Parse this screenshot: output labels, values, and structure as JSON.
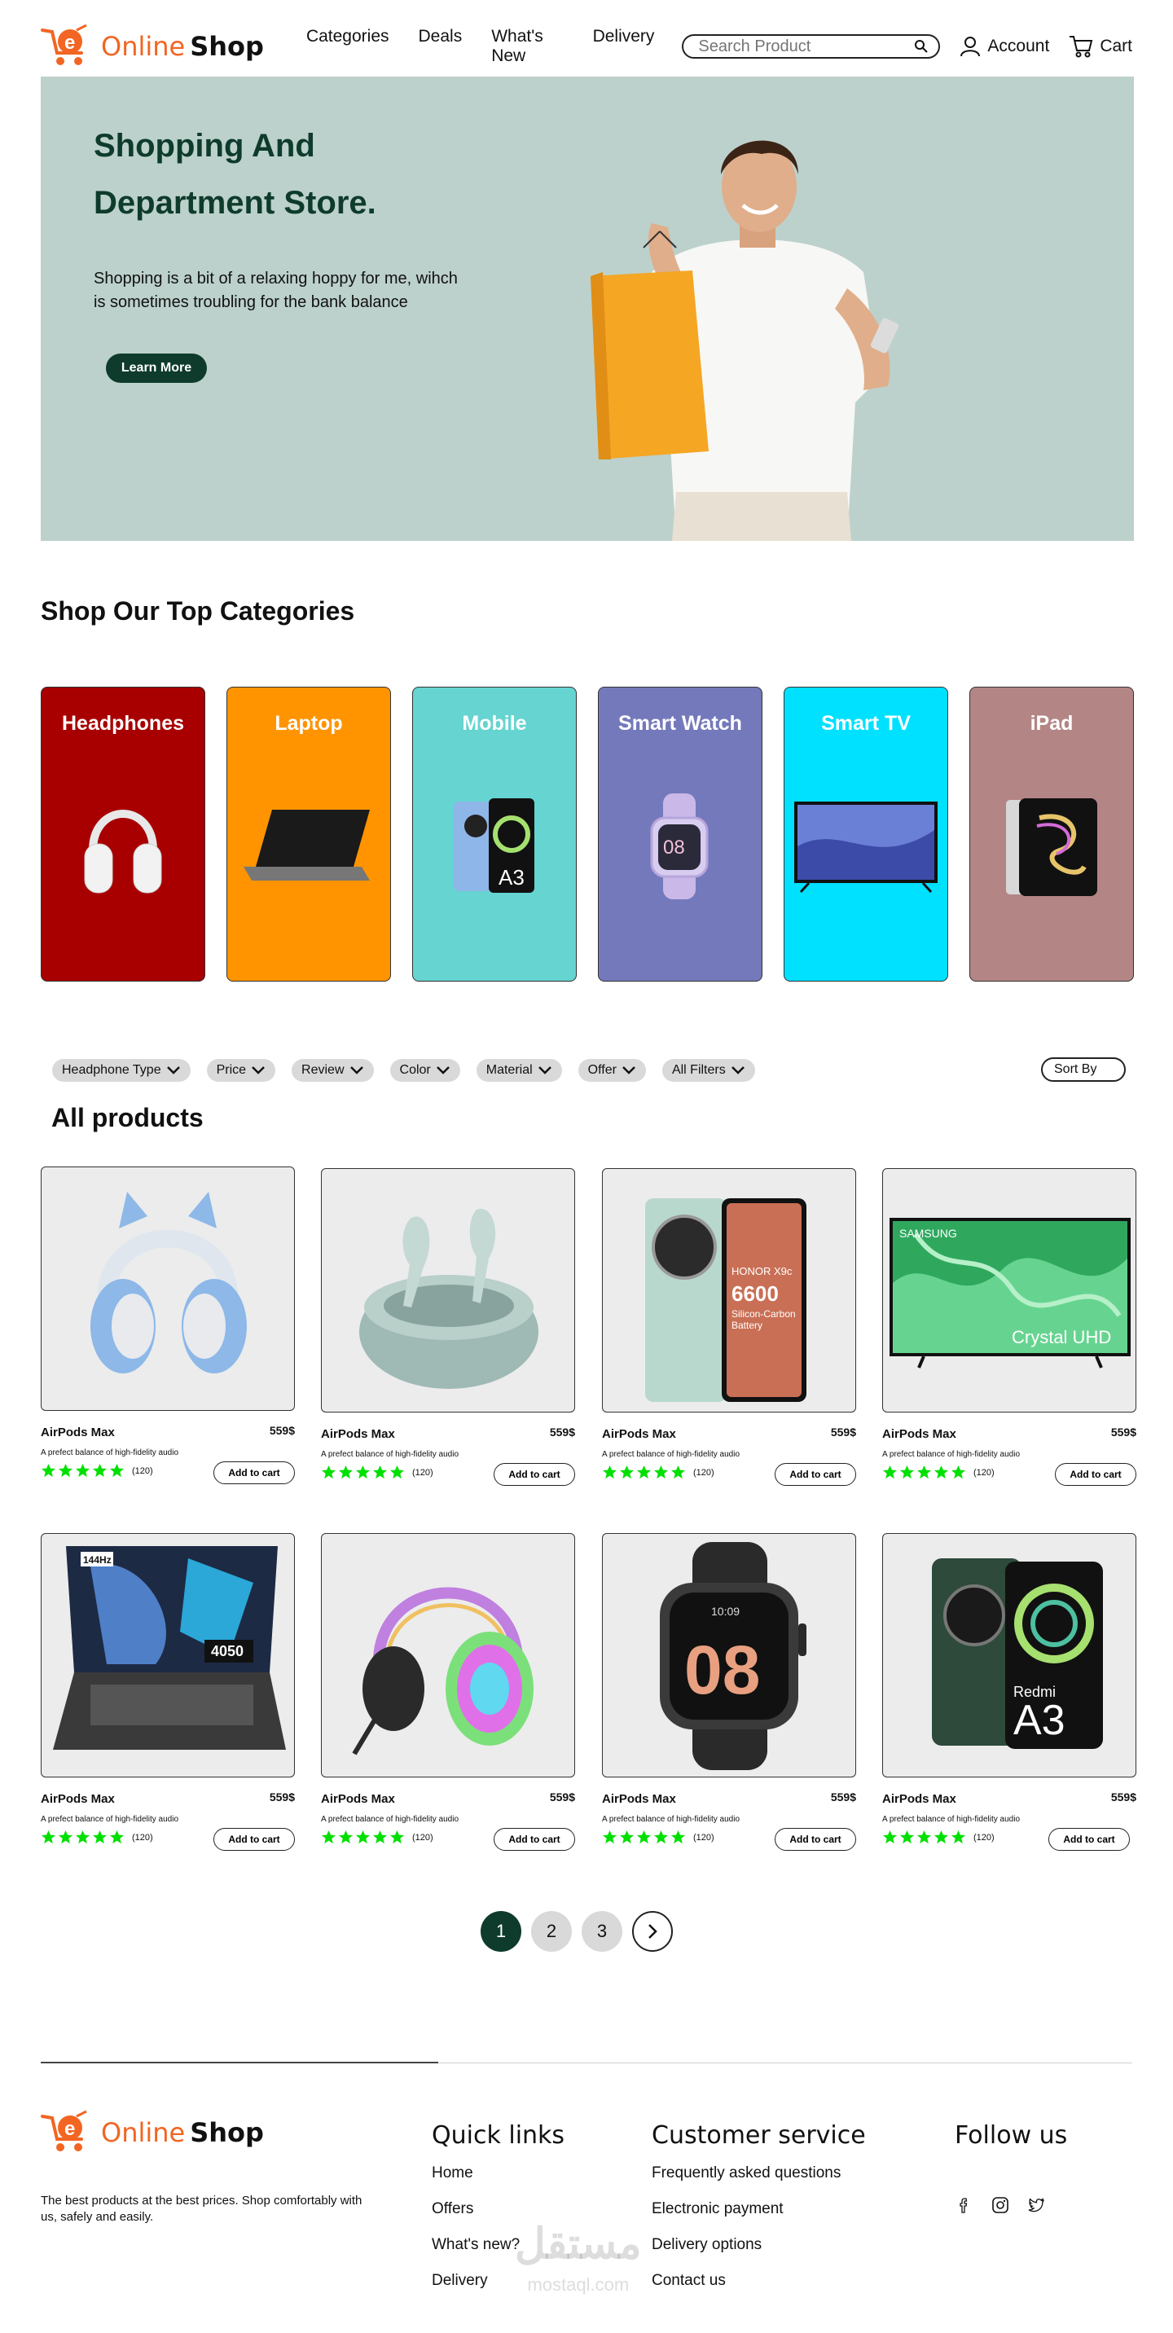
{
  "header": {
    "logo_word1": "Online",
    "logo_word2": "Shop",
    "nav": [
      "Categories",
      "Deals",
      "What's New",
      "Delivery"
    ],
    "search_placeholder": "Search Product",
    "account_label": "Account",
    "cart_label": "Cart"
  },
  "hero": {
    "title_line1": "Shopping And",
    "title_line2": "Department Store.",
    "description_line1": "Shopping is a bit of a relaxing hoppy for me, wihch",
    "description_line2": "is sometimes troubling  for the bank balance",
    "cta_label": "Learn More",
    "background": "#bcd1cb"
  },
  "categories": {
    "title": "Shop Our Top Categories",
    "items": [
      {
        "label": "Headphones",
        "color": "#a80000",
        "icon": "headphones-icon"
      },
      {
        "label": "Laptop",
        "color": "#ff9400",
        "icon": "laptop-icon"
      },
      {
        "label": "Mobile",
        "color": "#66d4d0",
        "icon": "mobile-icon"
      },
      {
        "label": "Smart Watch",
        "color": "#7479bb",
        "icon": "smartwatch-icon"
      },
      {
        "label": "Smart TV",
        "color": "#00e0ff",
        "icon": "tv-icon"
      },
      {
        "label": "iPad",
        "color": "#b48585",
        "icon": "tablet-icon"
      }
    ]
  },
  "filters": {
    "chips": [
      "Headphone Type",
      "Price",
      "Review",
      "Color",
      "Material",
      "Offer",
      "All Filters"
    ],
    "sort_label": "Sort By"
  },
  "products": {
    "title": "All products",
    "items": [
      {
        "name": "AirPods Max",
        "price": "559$",
        "desc": "A  prefect balance of high-fidelity audio",
        "rating": 5,
        "reviews": "(120)",
        "cta": "Add to cart",
        "icon": "kids-headphones-icon"
      },
      {
        "name": "AirPods Max",
        "price": "559$",
        "desc": "A  prefect balance of high-fidelity audio",
        "rating": 5,
        "reviews": "(120)",
        "cta": "Add to cart",
        "icon": "earbuds-icon"
      },
      {
        "name": "AirPods Max",
        "price": "559$",
        "desc": "A  prefect balance of high-fidelity audio",
        "rating": 5,
        "reviews": "(120)",
        "cta": "Add to cart",
        "icon": "foldable-phone-icon"
      },
      {
        "name": "AirPods Max",
        "price": "559$",
        "desc": "A  prefect balance of high-fidelity audio",
        "rating": 5,
        "reviews": "(120)",
        "cta": "Add to cart",
        "icon": "samsung-tv-icon"
      },
      {
        "name": "AirPods Max",
        "price": "559$",
        "desc": "A  prefect balance of high-fidelity audio",
        "rating": 5,
        "reviews": "(120)",
        "cta": "Add to cart",
        "icon": "gaming-laptop-icon"
      },
      {
        "name": "AirPods Max",
        "price": "559$",
        "desc": "A  prefect balance of high-fidelity audio",
        "rating": 5,
        "reviews": "(120)",
        "cta": "Add to cart",
        "icon": "rgb-headset-icon"
      },
      {
        "name": "AirPods Max",
        "price": "559$",
        "desc": "A  prefect balance of high-fidelity audio",
        "rating": 5,
        "reviews": "(120)",
        "cta": "Add to cart",
        "icon": "smartwatch-icon"
      },
      {
        "name": "AirPods Max",
        "price": "559$",
        "desc": "A  prefect balance of high-fidelity audio",
        "rating": 5,
        "reviews": "(120)",
        "cta": "Add to cart",
        "icon": "redmi-phone-icon"
      }
    ],
    "image_texts": {
      "phone_brand": "HONOR X9c",
      "phone_spec1": "6600",
      "phone_spec2": "Silicon-Carbon",
      "phone_spec3": "Battery",
      "tv_brand": "SAMSUNG",
      "tv_model": "Crystal UHD",
      "laptop_badge1": "144Hz",
      "laptop_badge2": "4050",
      "watch_time": "08",
      "watch_small_time": "10:09",
      "redmi_brand": "Redmi",
      "redmi_model": "A3"
    }
  },
  "pagination": {
    "pages": [
      "1",
      "2",
      "3"
    ],
    "active": "1"
  },
  "footer": {
    "about": "The best products at the best prices. Shop comfortably with us, safely and easily.",
    "quick_links_title": "Quick links",
    "quick_links": [
      "Home",
      "Offers",
      "What's new?",
      "Delivery"
    ],
    "customer_title": "Customer service",
    "customer_links": [
      "Frequently asked questions",
      "Electronic payment",
      "Delivery options",
      "Contact us"
    ],
    "follow_title": "Follow us",
    "social": [
      "facebook-icon",
      "instagram-icon",
      "twitter-icon"
    ],
    "watermark_main": "مستقل",
    "watermark_sub": "mostaql.com"
  },
  "colors": {
    "brand_green": "#0e3b2c",
    "brand_orange": "#f26522",
    "star_green": "#00e000"
  }
}
